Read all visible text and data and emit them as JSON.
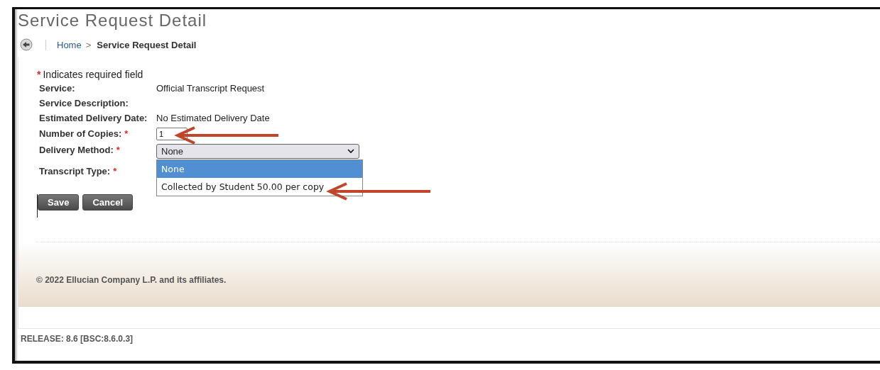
{
  "page_title": "Service Request Detail",
  "breadcrumb": {
    "home": "Home",
    "separator": ">",
    "current": "Service Request Detail"
  },
  "required_note": {
    "mark": "*",
    "text": "Indicates required field"
  },
  "fields": [
    {
      "kind": "text",
      "label": "Service:",
      "value": "Official Transcript Request"
    },
    {
      "kind": "text",
      "label": "Service Description:"
    },
    {
      "kind": "text",
      "label": "Estimated Delivery Date:",
      "value": "No Estimated Delivery Date"
    },
    {
      "kind": "input",
      "label": "Number of Copies:",
      "mark": "*",
      "value": "1"
    },
    {
      "kind": "select",
      "label": "Delivery Method:",
      "mark": "*",
      "value": "None",
      "expanded": true,
      "options": [
        {
          "label": "None",
          "selected": true
        },
        {
          "label": "Collected by Student 50.00 per copy",
          "selected": false
        }
      ]
    },
    {
      "kind": "empty",
      "label": "Transcript Type:",
      "mark": "*"
    }
  ],
  "buttons": [
    "Save",
    "Cancel"
  ],
  "footer": {
    "copyright": "© 2022 Ellucian Company L.P. and its affiliates."
  },
  "release": "RELEASE: 8.6 [BSC:8.6.0.3]"
}
